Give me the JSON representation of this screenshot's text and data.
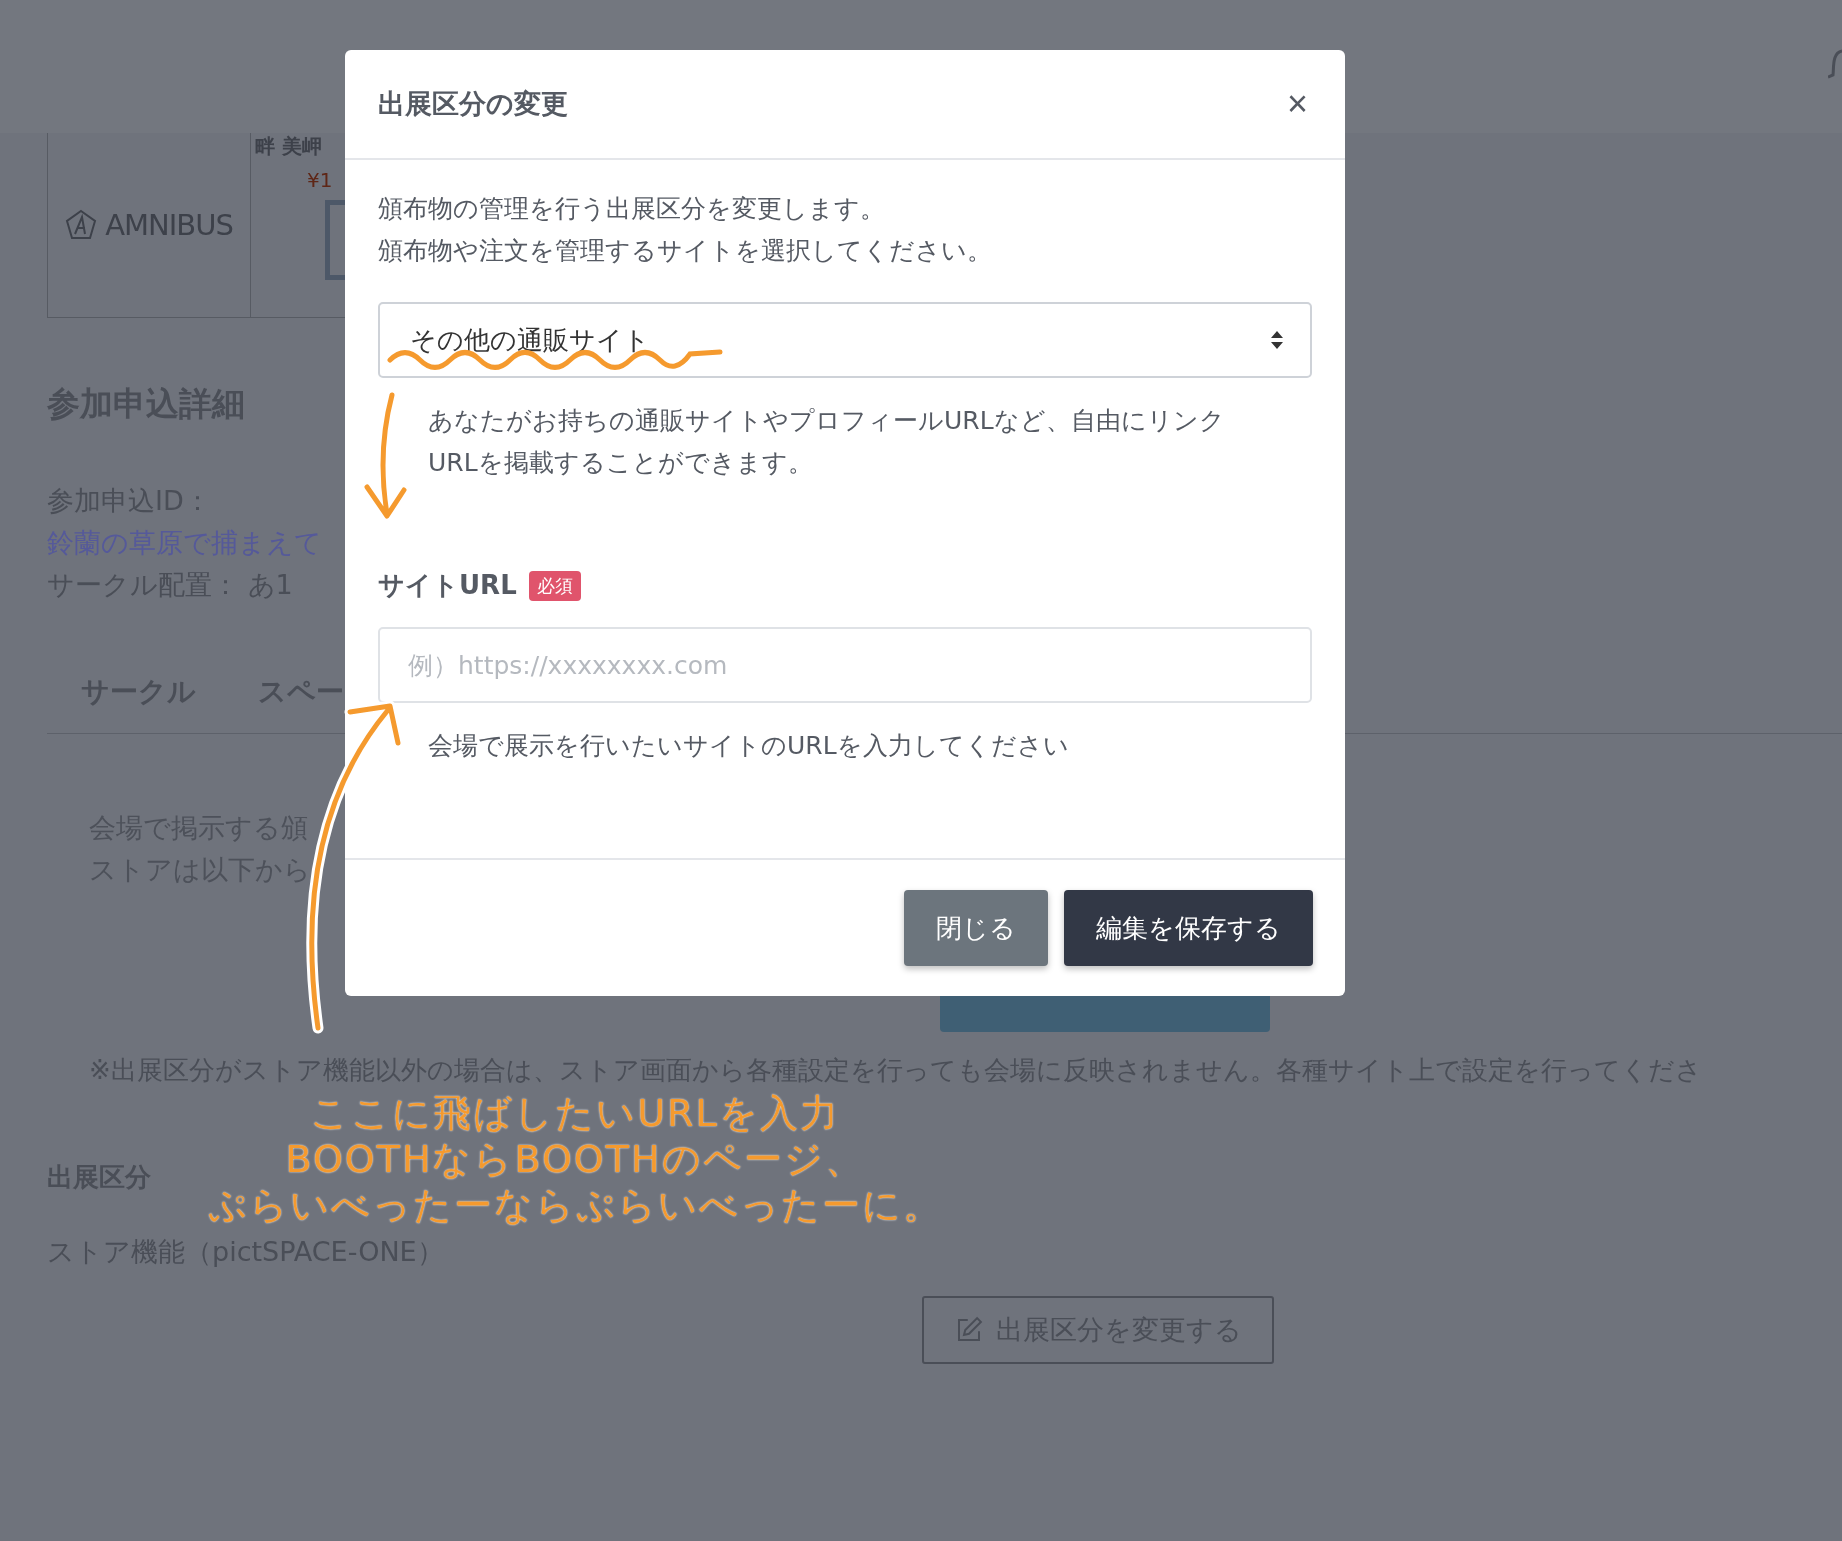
{
  "product_card": {
    "brand": "AMNIBUS",
    "item_name": "畔 美岬",
    "price": "¥1"
  },
  "details": {
    "heading": "参加申込詳細",
    "id_label": "参加申込ID：",
    "event_link": "鈴蘭の草原で捕まえて",
    "placement": "サークル配置： あ1"
  },
  "tabs": [
    {
      "label": "サークル"
    },
    {
      "label": "スペー"
    }
  ],
  "store_intro": [
    "会場で掲示する頒",
    "ストアは以下から"
  ],
  "note": "※出展区分がストア機能以外の場合は、ストア画面から各種設定を行っても会場に反映されません。各種サイト上で設定を行ってくださ",
  "exhibit_section": {
    "heading": "出展区分",
    "value": "ストア機能（pictSPACE-ONE）",
    "change_button": "出展区分を変更する"
  },
  "modal": {
    "title": "出展区分の変更",
    "close": "×",
    "description": [
      "頒布物の管理を行う出展区分を変更します。",
      "頒布物や注文を管理するサイトを選択してください。"
    ],
    "select_value": "その他の通販サイト",
    "select_help": "あなたがお持ちの通販サイトやプロフィールURLなど、自由にリンクURLを掲載することができます。",
    "url_label": "サイトURL",
    "required_badge": "必須",
    "url_placeholder": "例）https://xxxxxxxx.com",
    "url_help": "会場で展示を行いたいサイトのURLを入力してください",
    "buttons": [
      {
        "label": "閉じる",
        "kind": "secondary"
      },
      {
        "label": "編集を保存する",
        "kind": "primary"
      }
    ]
  },
  "annotation": {
    "lines": [
      "ここに飛ばしたいURLを入力",
      "BOOTHならBOOTHのページ、",
      "ぷらいべったーならぷらいべったーに。"
    ]
  }
}
